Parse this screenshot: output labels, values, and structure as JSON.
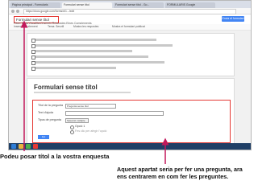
{
  "browser": {
    "tabs": [
      "Pàgina principal - Formularis",
      "Formulari sense títol",
      "Formulari sense títol - Go...",
      "FORMULARIS Google"
    ],
    "url": "https://docs.google.com/forms/d/1.../edit"
  },
  "docs": {
    "title_value": "Formulari sense títol",
    "menu": "Fitxer  Edita  Visualitza  Insereix  Respostes  Eines  Complements",
    "send_label": "Envia el formulari",
    "toolbar_items": [
      "Insereix un element",
      "Tema: Senzill",
      "Mostra les respostes",
      "Mostra el formulari publicat"
    ]
  },
  "form": {
    "title": "Formulari sense títol",
    "question": {
      "title_label": "Títol de la pregunta",
      "title_value": "Pregunta sense títol",
      "help_label": "Text d'ajuda",
      "type_label": "Tipus de pregunta",
      "type_value": "Selecció múltiple",
      "option1": "Opció 1",
      "add_option": "Fes clic per afegir l'opció",
      "done_label": "Fet"
    }
  },
  "annotations": {
    "left": "Podeu posar títol a la vostra enquesta",
    "right": "Aquest apartat seria per fer una pregunta, ara ens centrarem en com fer les preguntes."
  },
  "colors": {
    "highlight": "#e53935",
    "arrow": "#c2185b",
    "accent": "#4285f4"
  }
}
